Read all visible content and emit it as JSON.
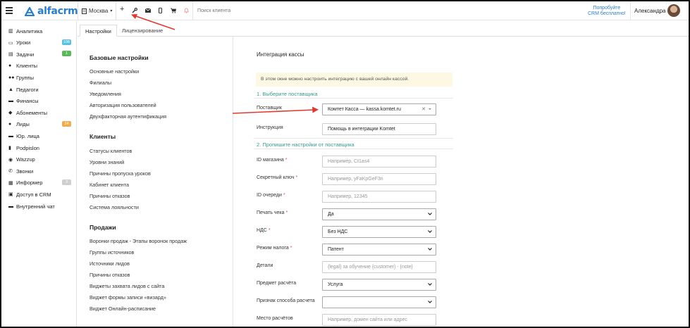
{
  "brand": {
    "name": "alfacrm"
  },
  "topbar": {
    "city": "Москва",
    "search_placeholder": "Поиск клиента",
    "try_line1": "Попробуйте",
    "try_line2": "CRM бесплатно!",
    "user_name": "Александра"
  },
  "sidebar": {
    "items": [
      {
        "label": "Аналитика",
        "icon": "analytics-icon"
      },
      {
        "label": "Уроки",
        "icon": "calendar-icon",
        "badge": "108",
        "badge_color": "#5bc0de"
      },
      {
        "label": "Задачи",
        "icon": "tasks-icon",
        "badge": "1",
        "badge_color": "#5cb85c"
      },
      {
        "label": "Клиенты",
        "icon": "user-icon"
      },
      {
        "label": "Группы",
        "icon": "users-icon"
      },
      {
        "label": "Педагоги",
        "icon": "graduation-icon"
      },
      {
        "label": "Финансы",
        "icon": "money-icon"
      },
      {
        "label": "Абонементы",
        "icon": "tag-icon"
      },
      {
        "label": "Лиды",
        "icon": "lead-icon",
        "badge": "24",
        "badge_color": "#f0ad4e"
      },
      {
        "label": "Юр. лица",
        "icon": "briefcase-icon"
      },
      {
        "label": "Podpislon",
        "icon": "podpislon-icon"
      },
      {
        "label": "Wazzup",
        "icon": "whatsapp-icon"
      },
      {
        "label": "Звонки",
        "icon": "phone-icon"
      },
      {
        "label": "Информер",
        "icon": "informer-icon",
        "badge": "3",
        "badge_color": "#cfcfcf"
      },
      {
        "label": "Доступ в CRM",
        "icon": "lock-icon"
      },
      {
        "label": "Внутренний чат",
        "icon": "chat-icon"
      }
    ]
  },
  "tabs": [
    {
      "label": "Настройки",
      "active": true
    },
    {
      "label": "Лицензирование",
      "active": false
    }
  ],
  "menu": {
    "base_title": "Базовые настройки",
    "base_items": [
      "Основные настройки",
      "Филиалы",
      "Уведомления",
      "Авторизация пользователей",
      "Двухфакторная аутентификация"
    ],
    "clients_title": "Клиенты",
    "clients_items": [
      "Статусы клиентов",
      "Уровни знаний",
      "Причины пропуска уроков",
      "Кабинет клиента",
      "Причины отказов",
      "Система лояльности"
    ],
    "sales_title": "Продажи",
    "sales_items": [
      "Воронки продаж - Этапы воронок продаж",
      "Группы источников",
      "Источники лидов",
      "Причины отказов",
      "Виджеты захвата лидов с сайта",
      "Виджет формы записи «визард»",
      "Виджет Онлайн-расписание"
    ]
  },
  "form": {
    "title": "Интеграция кассы",
    "info": "В этом окне можно настроить интеграцию с вашей онлайн кассой.",
    "section1": "1. Выберите поставщика",
    "section2": "2. Пропишите настройки от поставщика",
    "provider_label": "Поставщик",
    "provider_value": "Комтет Касса — kassa.komtet.ru",
    "instruction_label": "Инструкция",
    "instruction_value": "Помощь в интеграции Komtet",
    "shop_id_label": "ID магазина",
    "shop_id_placeholder": "Например, Ct1as4",
    "secret_label": "Секретный ключ",
    "secret_placeholder": "Например, yFaKpGeF3n",
    "queue_label": "ID очереди",
    "queue_placeholder": "Например, 12345",
    "print_label": "Печать чека",
    "print_value": "Да",
    "vat_label": "НДС",
    "vat_value": "Без НДС",
    "tax_label": "Режим налога",
    "tax_value": "Патент",
    "details_label": "Детали",
    "details_placeholder": "{legal} за обучение {customer} - {note}",
    "subject_label": "Предмет расчёта",
    "subject_value": "Услуга",
    "method_label": "Признак способа расчета",
    "method_value": "",
    "place_label": "Место расчётов",
    "place_placeholder": "Например, домен сайта или адрес",
    "required_mark": "*"
  },
  "colors": {
    "brand": "#2a7dc9",
    "section": "#3a9a8e",
    "annotation_arrow": "#e03a2f"
  }
}
